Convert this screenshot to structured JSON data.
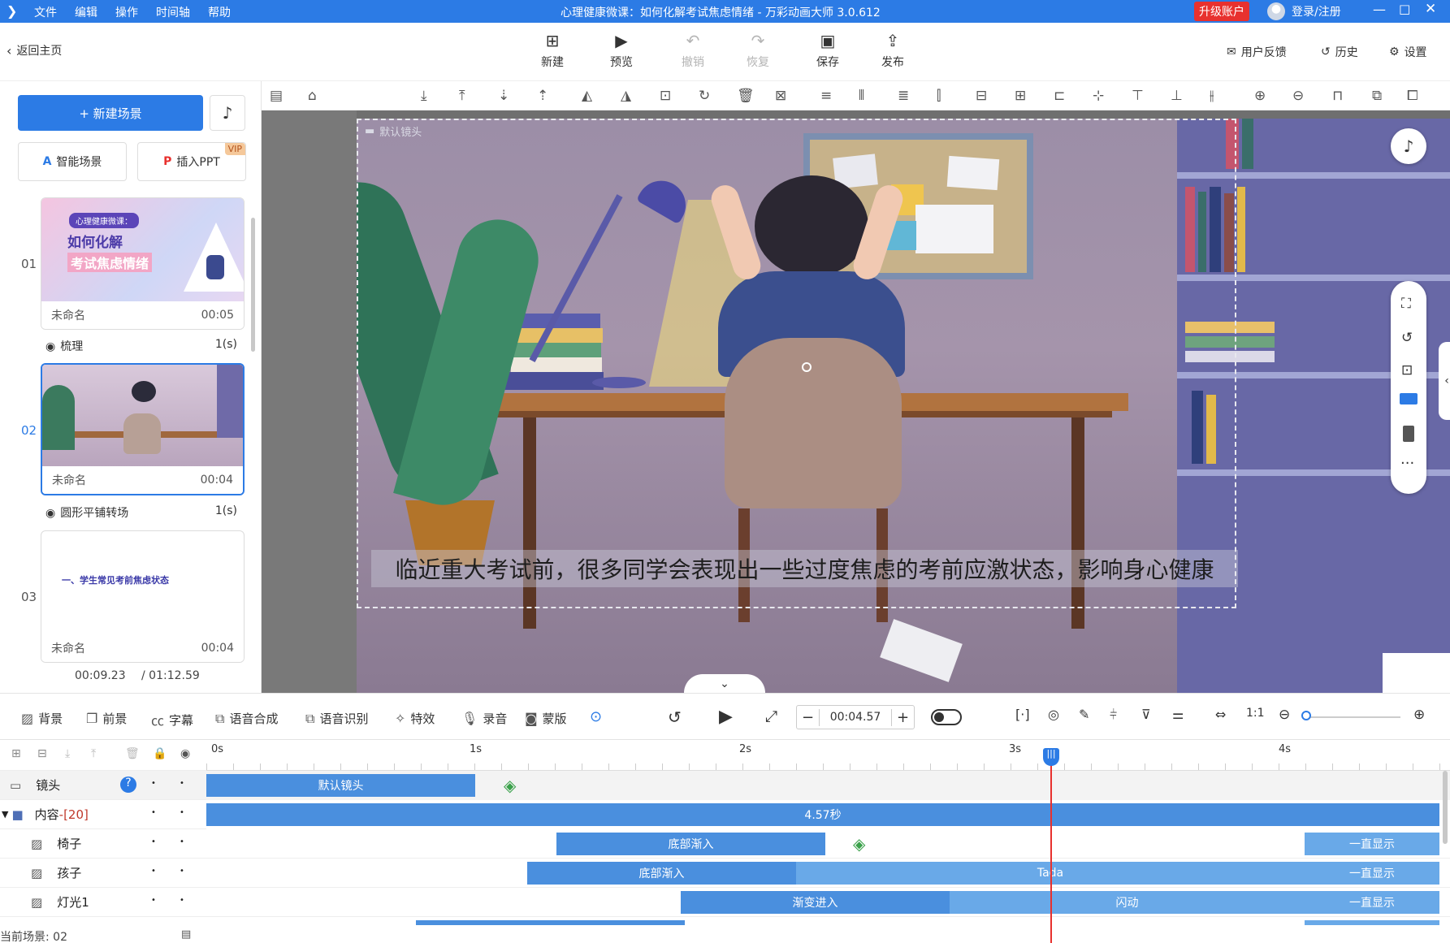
{
  "app": {
    "window_title": "心理健康微课：如何化解考试焦虑情绪 - 万彩动画大师 3.0.612",
    "menu": [
      "文件",
      "编辑",
      "操作",
      "时间轴",
      "帮助"
    ],
    "upgrade_label": "升级账户",
    "login_label": "登录/注册"
  },
  "toolbar": {
    "back_label": "返回主页",
    "buttons": [
      {
        "label": "新建",
        "icon": "plus-square-icon",
        "enabled": true
      },
      {
        "label": "预览",
        "icon": "play-icon",
        "enabled": true
      },
      {
        "label": "撤销",
        "icon": "undo-icon",
        "enabled": false
      },
      {
        "label": "恢复",
        "icon": "redo-icon",
        "enabled": false
      },
      {
        "label": "保存",
        "icon": "save-icon",
        "enabled": true
      },
      {
        "label": "发布",
        "icon": "publish-icon",
        "enabled": true
      }
    ],
    "right": [
      {
        "label": "用户反馈",
        "icon": "feedback-icon"
      },
      {
        "label": "历史",
        "icon": "history-icon"
      },
      {
        "label": "设置",
        "icon": "gear-icon"
      }
    ]
  },
  "scenes_panel": {
    "new_scene_label": "+ 新建场景",
    "smart_scene_label": "智能场景",
    "insert_ppt_label": "插入PPT",
    "vip_badge": "VIP",
    "scenes": [
      {
        "num": "01",
        "name": "未命名",
        "duration": "00:05",
        "thumb_text_1": "心理健康微课：",
        "thumb_text_2": "如何化解",
        "thumb_text_3": "考试焦虑情绪"
      },
      {
        "num": "02",
        "name": "未命名",
        "duration": "00:04"
      },
      {
        "num": "03",
        "name": "未命名",
        "duration": "00:04",
        "thumb_text_1": "一、学生常见考前焦虑状态"
      }
    ],
    "transitions": [
      {
        "name": "梳理",
        "duration": "1(s)"
      },
      {
        "name": "圆形平铺转场",
        "duration": "1(s)"
      }
    ],
    "current_time": "00:09.23",
    "total_time": "/ 01:12.59"
  },
  "canvas": {
    "camera_label": "默认镜头",
    "subtitle": "临近重大考试前，很多同学会表现出一些过度焦虑的考前应激状态，影响身心健康"
  },
  "bottom_toolbar": {
    "items": [
      "背景",
      "前景",
      "字幕",
      "语音合成",
      "语音识别",
      "特效",
      "录音",
      "蒙版"
    ],
    "time_value": "00:04.57"
  },
  "timeline": {
    "ruler": [
      "0s",
      "1s",
      "2s",
      "3s",
      "4s"
    ],
    "tracks": [
      {
        "label": "镜头",
        "bars": [
          {
            "text": "默认镜头"
          }
        ]
      },
      {
        "label": "内容",
        "count": "-[20]",
        "bars": [
          {
            "text": "4.57秒"
          }
        ]
      },
      {
        "label": "椅子",
        "bars": [
          {
            "text": "底部渐入"
          },
          {
            "text": "一直显示"
          }
        ]
      },
      {
        "label": "孩子",
        "bars": [
          {
            "text": "底部渐入"
          },
          {
            "text": "Tada"
          },
          {
            "text": "一直显示"
          }
        ]
      },
      {
        "label": "灯光1",
        "bars": [
          {
            "text": "渐变进入"
          },
          {
            "text": "闪动"
          },
          {
            "text": "一直显示"
          }
        ]
      }
    ],
    "current_scene_label": "当前场景: 02"
  },
  "colors": {
    "accent": "#2c7be5",
    "track_bar": "#4a8fde",
    "track_bar_light": "#69a9e8",
    "playhead": "#e8312e",
    "upgrade": "#e8312e"
  }
}
